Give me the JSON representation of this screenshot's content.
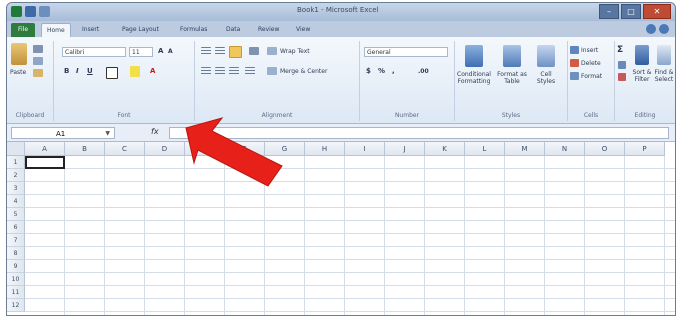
{
  "window": {
    "title": "Book1 - Microsoft Excel"
  },
  "tabs": [
    "File",
    "Home",
    "Insert",
    "Page Layout",
    "Formulas",
    "Data",
    "Review",
    "View"
  ],
  "ribbon": {
    "clipboard": {
      "paste": "Paste",
      "label": "Clipboard"
    },
    "font": {
      "name": "Calibri",
      "size": "11",
      "bold": "B",
      "italic": "I",
      "underline": "U",
      "grow": "A",
      "shrink": "A",
      "color": "A",
      "label": "Font"
    },
    "alignment": {
      "wrap_text": "Wrap Text",
      "merge_center": "Merge & Center",
      "label": "Alignment"
    },
    "number": {
      "format": "General",
      "currency": "$",
      "percent": "%",
      "comma": ",",
      "dec": ".00",
      "label": "Number"
    },
    "styles": {
      "conditional": "Conditional Formatting",
      "format_table": "Format as Table",
      "cell_styles": "Cell Styles",
      "label": "Styles"
    },
    "cells": {
      "insert": "Insert",
      "delete": "Delete",
      "format": "Format",
      "label": "Cells"
    },
    "editing": {
      "sigma": "Σ",
      "sort_filter": "Sort & Filter",
      "find_select": "Find & Select",
      "label": "Editing"
    }
  },
  "formula_bar": {
    "name_box": "A1",
    "fx": "fx",
    "value": ""
  },
  "columns": [
    "A",
    "B",
    "C",
    "D",
    "E",
    "F",
    "G",
    "H",
    "I",
    "J",
    "K",
    "L",
    "M",
    "N",
    "O",
    "P"
  ],
  "rows": [
    "1",
    "2",
    "3",
    "4",
    "5",
    "6",
    "7",
    "8",
    "9",
    "10",
    "11",
    "12"
  ],
  "colors": {
    "file_tab": "#2e7c3e",
    "arrow": "#e8201a",
    "ribbon": "#dde8f5"
  },
  "annotation": {
    "icon": "red-arrow-pointing-to-formula-bar"
  }
}
